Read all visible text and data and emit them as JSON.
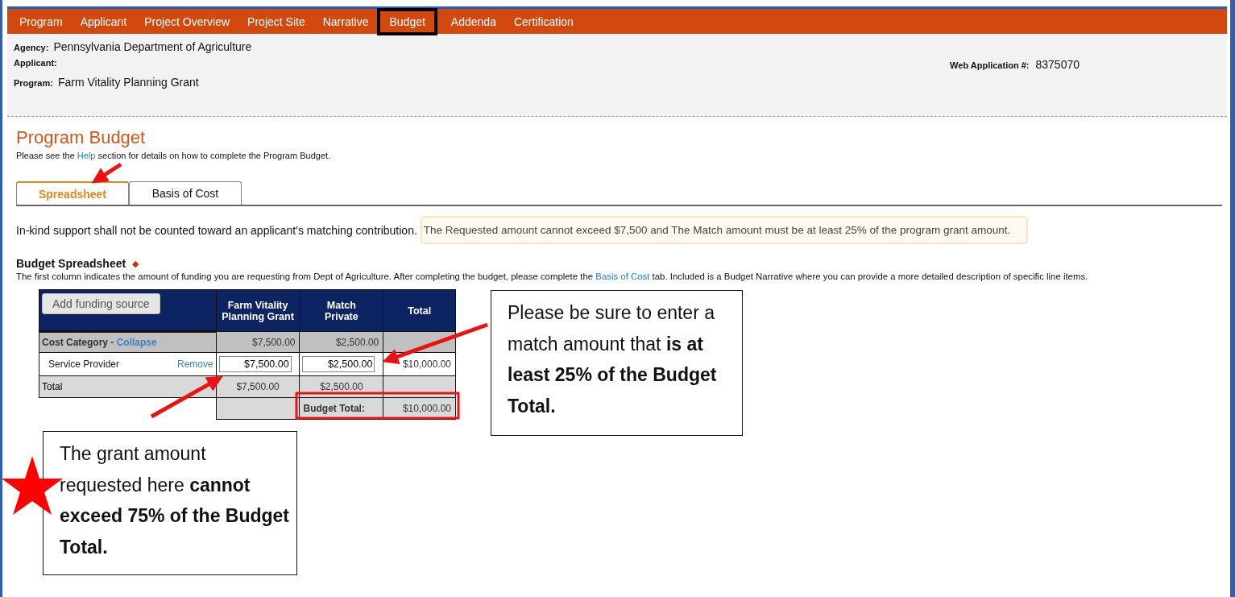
{
  "nav": [
    {
      "label": "Program",
      "selected": false
    },
    {
      "label": "Applicant",
      "selected": false
    },
    {
      "label": "Project Overview",
      "selected": false
    },
    {
      "label": "Project Site",
      "selected": false
    },
    {
      "label": "Narrative",
      "selected": false
    },
    {
      "label": "Budget",
      "selected": true
    },
    {
      "label": "Addenda",
      "selected": false
    },
    {
      "label": "Certification",
      "selected": false
    }
  ],
  "header": {
    "fields": [
      {
        "label": "Agency:",
        "value": "Pennsylvania Department of Agriculture"
      },
      {
        "label": "Applicant:"
      },
      {
        "label": "Program:",
        "value": "Farm Vitality Planning Grant"
      }
    ],
    "web_application": {
      "label": "Web Application #:",
      "value": "8375070"
    }
  },
  "title": "Program Budget",
  "help_text": {
    "before": "Please see the ",
    "link": "Help",
    "after": " section for details on how to complete the Program Budget."
  },
  "tabs": [
    {
      "label": "Spreadsheet",
      "selected": true
    },
    {
      "label": "Basis of Cost",
      "selected": false
    }
  ],
  "notice": "In-kind support shall not be counted toward an applicant’s matching contribution.",
  "alert": "The Requested amount cannot exceed $7,500 and The Match amount must be at least 25% of the program grant amount.",
  "section": {
    "title": "Budget Spreadsheet",
    "required_mark": "◆",
    "description": {
      "before": "The first column indicates the amount of funding you are requesting from Dept of Agriculture.  After completing the budget, please complete the ",
      "link": "Basis of Cost",
      "after": " tab.  Included is a Budget Narrative where you can provide a more detailed description of specific line items."
    }
  },
  "table": {
    "add_button": "Add funding source",
    "columns": [
      "Farm Vitality Planning Grant",
      "Match Private",
      "Total"
    ],
    "category": {
      "label": "Cost Category -",
      "link": "Collapse",
      "values": [
        "$7,500.00",
        "$2,500.00"
      ]
    },
    "items": [
      {
        "name": "Service Provider",
        "link": "Remove",
        "inputs": [
          "$7,500.00",
          "$2,500.00"
        ],
        "total": "$10,000.00"
      }
    ],
    "total_row": {
      "label": "Total",
      "values": [
        "$7,500.00",
        "$2,500.00"
      ]
    },
    "budget_total": {
      "label": "Budget Total:",
      "value": "$10,000.00"
    }
  },
  "callouts": [
    {
      "text": "Please be sure to enter a match amount that **is at least 25% of the Budget Total.**"
    },
    {
      "text": "The grant amount requested here **cannot exceed 75% of the Budget Total.**"
    }
  ]
}
